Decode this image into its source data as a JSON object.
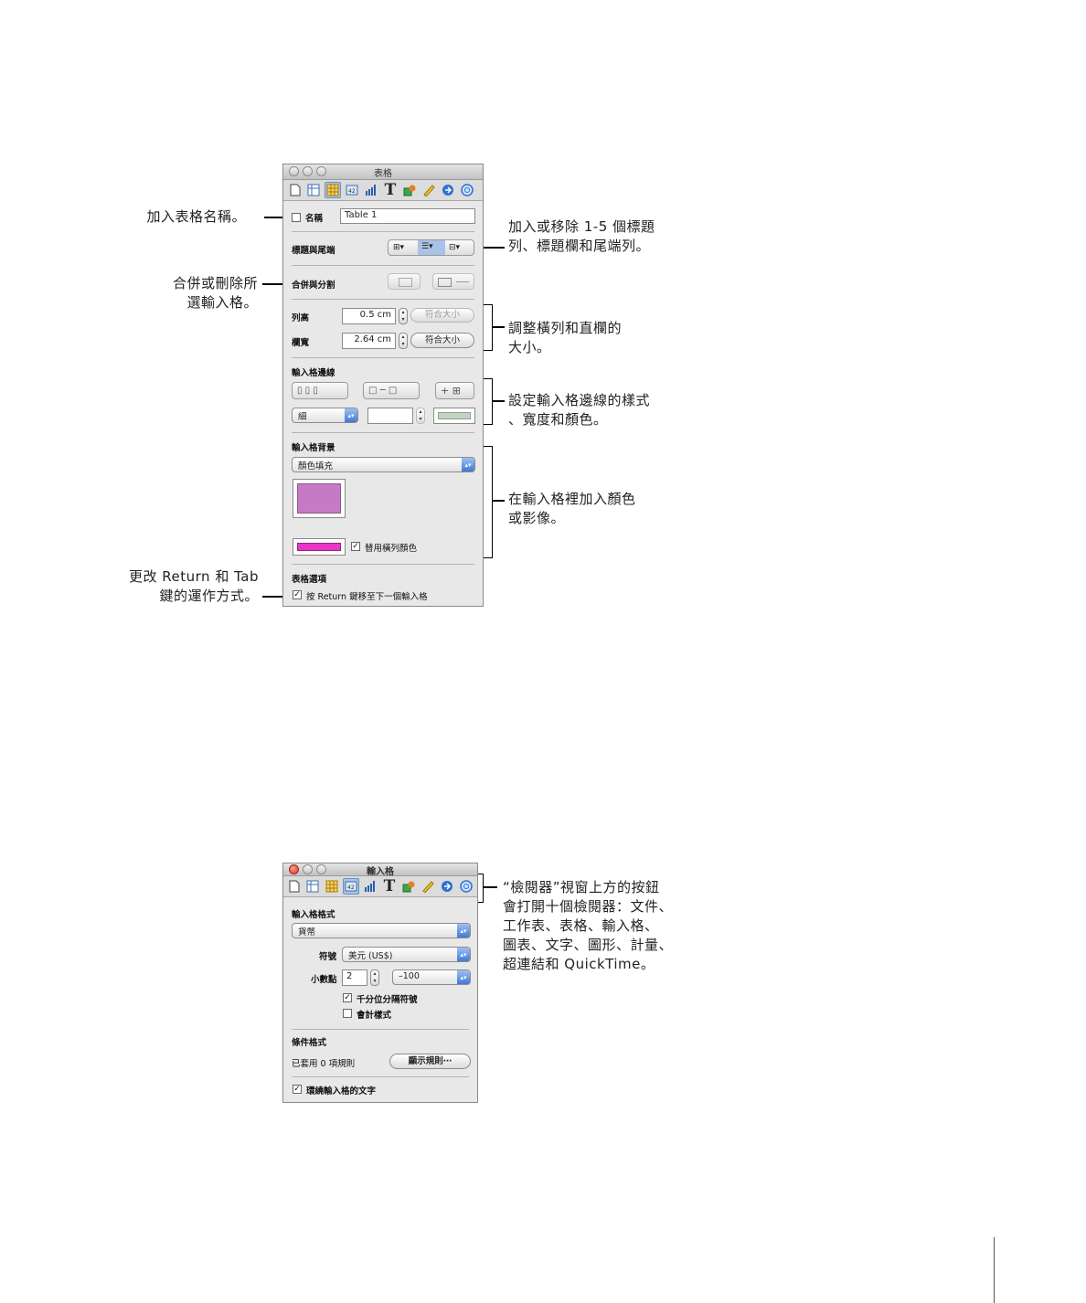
{
  "callouts": {
    "add_name": "加入表格名稱。",
    "merge_line1": "合併或刪除所",
    "merge_line2": "選輸入格。",
    "return_line1": "更改 Return 和 Tab",
    "return_line2": "鍵的運作方式。",
    "header_line1": "加入或移除 1-5 個標題",
    "header_line2": "列、標題欄和尾端列。",
    "resize_line1": "調整橫列和直欄的",
    "resize_line2": "大小。",
    "border_line1": "設定輸入格邊線的樣式",
    "border_line2": "、寬度和顏色。",
    "bg_line1": "在輸入格裡加入顏色",
    "bg_line2": "或影像。",
    "inspector_line1": "“檢閱器”視窗上方的按鈕",
    "inspector_line2": "會打開十個檢閱器：文件、",
    "inspector_line3": "工作表、表格、輸入格、",
    "inspector_line4": "圖表、文字、圖形、計量、",
    "inspector_line5": "超連結和 QuickTime。"
  },
  "table_inspector": {
    "title": "表格",
    "name_label": "名稱",
    "name_value": "Table 1",
    "header_footer_label": "標題與尾端",
    "merge_split_label": "合併與分割",
    "row_height_label": "列高",
    "row_height_value": "0.5 cm",
    "col_width_label": "欄寬",
    "col_width_value": "2.64 cm",
    "fit_label": "符合大小",
    "cell_borders_label": "輸入格邊線",
    "border_style_value": "細",
    "cell_background_label": "輸入格背景",
    "fill_value": "顏色填充",
    "fill_color": "#c67ac6",
    "alt_color": "#ea35c8",
    "alt_row_label": "替用橫列顏色",
    "alt_row_checked": true,
    "table_options_label": "表格選項",
    "return_option_label": "按 Return 鍵移至下一個輸入格",
    "return_option_checked": true,
    "name_checked": false
  },
  "cell_inspector": {
    "title": "輸入格",
    "format_label": "輸入格格式",
    "format_value": "貨幣",
    "symbol_label": "符號",
    "symbol_value": "美元 (US$)",
    "decimals_label": "小數點",
    "decimals_value": "2",
    "negative_value": "–100",
    "thousands_label": "千分位分隔符號",
    "thousands_checked": true,
    "accounting_label": "會計樣式",
    "accounting_checked": false,
    "conditional_label": "條件格式",
    "rules_applied": "已套用 0 項規則",
    "show_rules_label": "顯示規則⋯",
    "wrap_label": "環繞輸入格的文字",
    "wrap_checked": true
  },
  "toolbar_icons": [
    "document-icon",
    "sheet-icon",
    "table-icon",
    "cell-icon",
    "chart-icon",
    "text-icon",
    "shape-icon",
    "metrics-icon",
    "hyperlink-icon",
    "quicktime-icon"
  ],
  "colors": {
    "select_blue": "#3f7ad6",
    "selected_tab": "#a9c2e6"
  }
}
